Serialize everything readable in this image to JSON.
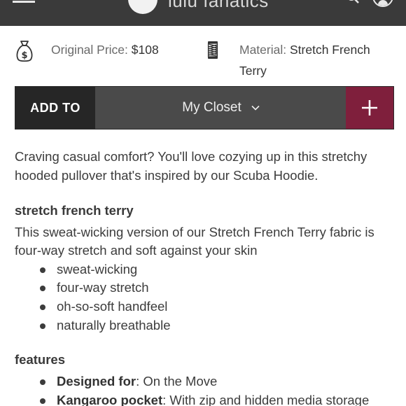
{
  "header": {
    "brand": "lulu fanatics",
    "colors": {
      "bar": "#3a3a3a"
    },
    "icons": [
      "menu-icon",
      "logo-icon",
      "search-icon",
      "account-icon"
    ]
  },
  "product_info": {
    "price_label": "Original Price:",
    "price_value": "$108",
    "material_label": "Material:",
    "material_value": "Stretch French Terry",
    "icons": [
      "money-bag-icon",
      "fabric-spool-icon"
    ]
  },
  "add_bar": {
    "add_to_label": "ADD TO",
    "closet_label": "My Closet",
    "colors": {
      "add_to_bg": "#262626",
      "closet_bg": "#4a4a4a",
      "plus_bg": "#7f1f3c"
    }
  },
  "description": {
    "intro": "Craving casual comfort? You'll love cozying up in this stretchy hooded pullover that's inspired by our Scuba Hoodie.",
    "fabric_heading": "stretch french terry",
    "fabric_text": "This sweat-wicking version of our Stretch French Terry fabric is four-way stretch and soft against your skin",
    "fabric_bullets": [
      "sweat-wicking",
      "four-way stretch",
      "oh-so-soft handfeel",
      "naturally breathable"
    ],
    "features_heading": "features",
    "features": [
      {
        "name": "Designed for",
        "text": ": On the Move"
      },
      {
        "name": "Kangaroo pocket",
        "text": ": With zip and hidden media storage"
      }
    ]
  }
}
